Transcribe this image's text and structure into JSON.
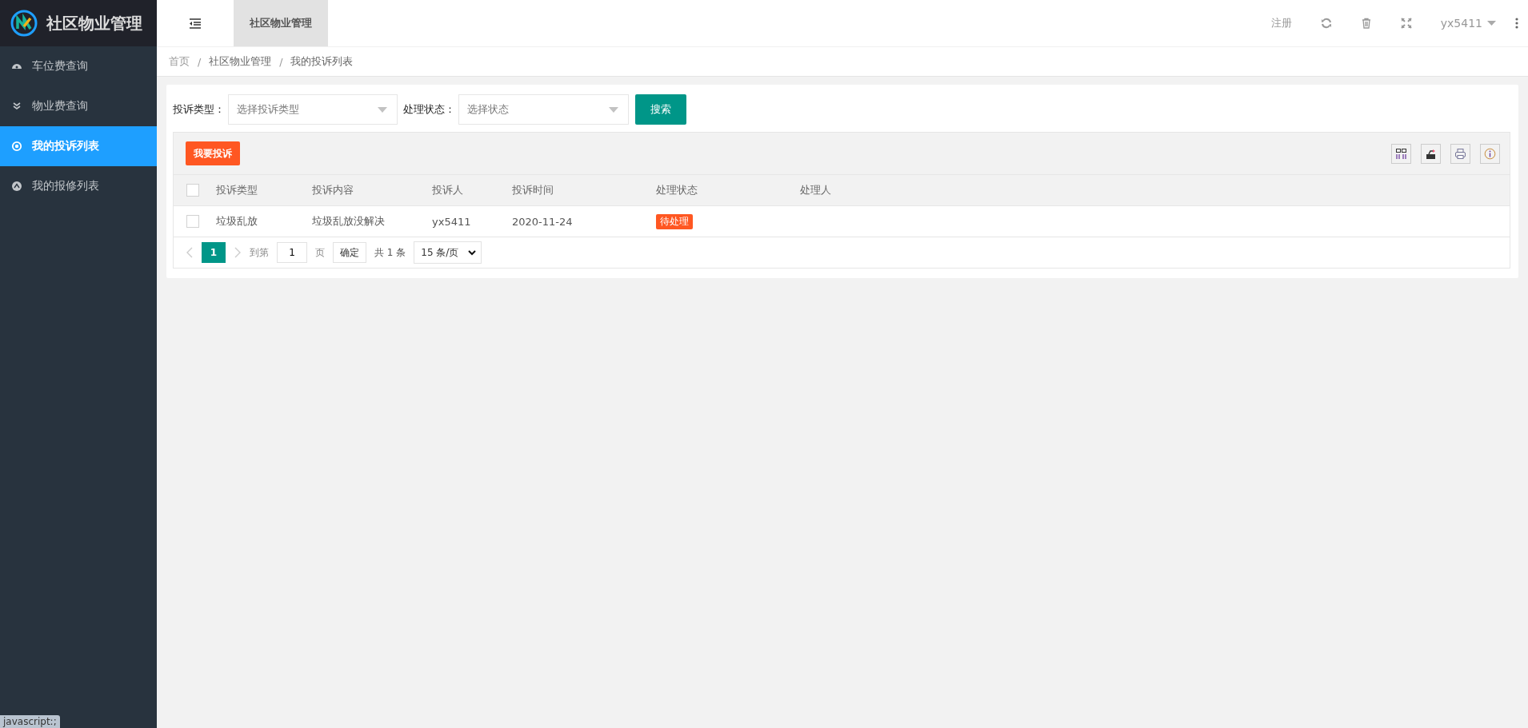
{
  "app": {
    "title": "社区物业管理"
  },
  "sidebar": {
    "items": [
      {
        "label": "车位费查询",
        "kind": "gauge",
        "selected": false
      },
      {
        "label": "物业费查询",
        "kind": "chevrons",
        "selected": false
      },
      {
        "label": "我的投诉列表",
        "kind": "target",
        "selected": true
      },
      {
        "label": "我的报修列表",
        "kind": "badge",
        "selected": false
      }
    ]
  },
  "header": {
    "tabs": [
      {
        "label": "社区物业管理",
        "selected": true
      }
    ],
    "register": "注册",
    "user": "yx5411"
  },
  "breadcrumb": [
    {
      "label": "首页"
    },
    {
      "separator": "/",
      "label": "社区物业管理"
    },
    {
      "separator": "/",
      "label": "我的投诉列表"
    }
  ],
  "filters": [
    {
      "label": "投诉类型：",
      "placeholder": "选择投诉类型"
    },
    {
      "label": "处理状态：",
      "placeholder": "选择状态"
    }
  ],
  "search_button": "搜索",
  "add_button": "我要投诉",
  "table": {
    "select_all_checked": false,
    "columns": [
      "投诉类型",
      "投诉内容",
      "投诉人",
      "投诉时间",
      "处理状态",
      "处理人"
    ],
    "rows": [
      {
        "checked": false,
        "cells": [
          "垃圾乱放",
          "垃圾乱放没解决",
          "yx5411",
          "2020-11-24"
        ],
        "status": "待处理"
      }
    ]
  },
  "pager": {
    "pages": [
      {
        "label": "1",
        "selected": true
      }
    ],
    "goto": "到第",
    "page_value": "1",
    "page_unit": "页",
    "confirm": "确定",
    "total": "共 1 条",
    "page_size": "15 条/页"
  },
  "status_bar": "javascript:;"
}
